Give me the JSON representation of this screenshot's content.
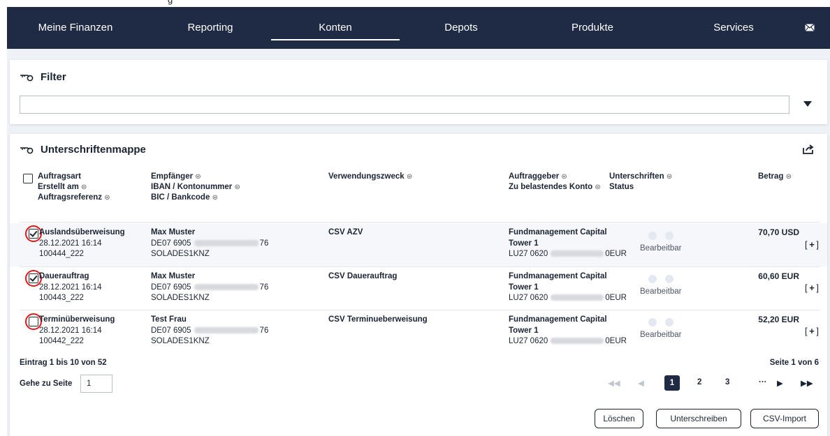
{
  "top_fragment": "g",
  "nav": {
    "items": [
      {
        "label": "Meine Finanzen"
      },
      {
        "label": "Reporting"
      },
      {
        "label": "Konten"
      },
      {
        "label": "Depots"
      },
      {
        "label": "Produkte"
      },
      {
        "label": "Services"
      }
    ],
    "active": "Konten",
    "mail_icon": "envelope-icon"
  },
  "filter": {
    "title": "Filter",
    "input_value": ""
  },
  "mappe": {
    "title": "Unterschriftenmappe",
    "headers": {
      "col1": [
        "Auftragsart",
        "Erstellt am",
        "Auftragsreferenz"
      ],
      "col2": [
        "Empfänger",
        "IBAN / Kontonummer",
        "BIC / Bankcode"
      ],
      "col3": [
        "Verwendungszweck"
      ],
      "col4": [
        "Auftraggeber",
        "Zu belastendes Konto"
      ],
      "col5": [
        "Unterschriften",
        "Status"
      ],
      "col6": [
        "Betrag"
      ]
    },
    "sort_glyph": "⊜",
    "rows": [
      {
        "type": "Auslandsüberweisung",
        "created": "28.12.2021 16:14",
        "ref": "100444_222",
        "recipient": "Max Muster",
        "iban_start": "DE07 6905",
        "iban_end": "76",
        "bic": "SOLADES1KNZ",
        "purpose": "CSV AZV",
        "orderer_line1": "Fundmanagement Capital",
        "orderer_line2": "Tower 1",
        "account_start": "LU27 0620",
        "account_end": "0EUR",
        "status": "Bearbeitbar",
        "amount": "70,70 USD",
        "checked": true
      },
      {
        "type": "Dauerauftrag",
        "created": "28.12.2021 16:14",
        "ref": "100443_222",
        "recipient": "Max Muster",
        "iban_start": "DE07 6905",
        "iban_end": "76",
        "bic": "SOLADES1KNZ",
        "purpose": "CSV Dauerauftrag",
        "orderer_line1": "Fundmanagement Capital",
        "orderer_line2": "Tower 1",
        "account_start": "LU27 0620",
        "account_end": "0EUR",
        "status": "Bearbeitbar",
        "amount": "60,60 EUR",
        "checked": true
      },
      {
        "type": "Terminüberweisung",
        "created": "28.12.2021 16:14",
        "ref": "100442_222",
        "recipient": "Test Frau",
        "iban_start": "DE07 6905",
        "iban_end": "76",
        "bic": "SOLADES1KNZ",
        "purpose": "CSV Terminueberweisung",
        "orderer_line1": "Fundmanagement Capital",
        "orderer_line2": "Tower 1",
        "account_start": "LU27 0620",
        "account_end": "0EUR",
        "status": "Bearbeitbar",
        "amount": "52,20 EUR",
        "checked": false
      }
    ],
    "entry_info": "Eintrag 1 bis 10 von 52",
    "page_info": "Seite 1 von 6",
    "goto_label": "Gehe zu Seite",
    "goto_value": "1",
    "pages": [
      "1",
      "2",
      "3"
    ],
    "ellipsis": "···",
    "buttons": {
      "delete": "Löschen",
      "sign": "Unterschreiben",
      "csv": "CSV-Import"
    }
  }
}
